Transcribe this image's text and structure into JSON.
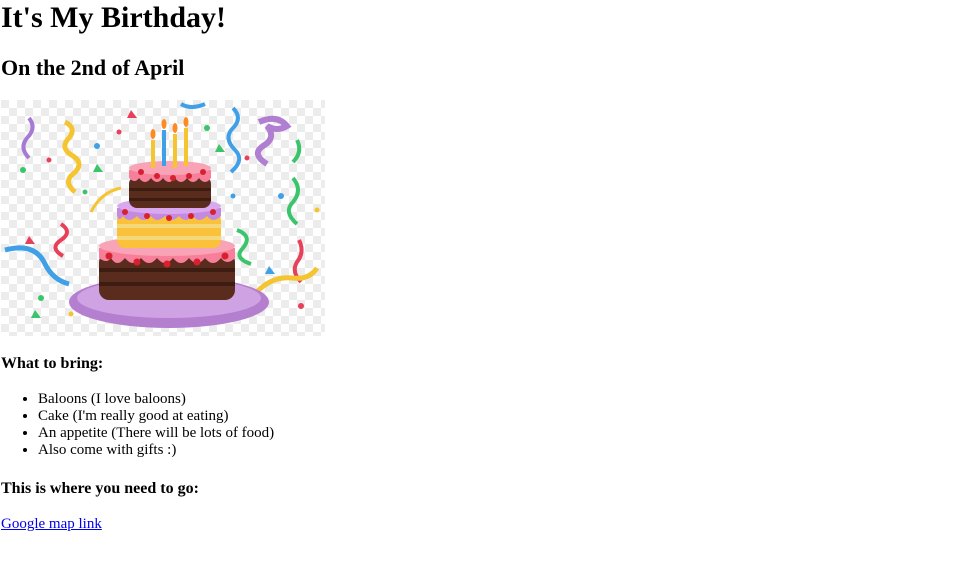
{
  "heading": "It's My Birthday!",
  "subheading": "On the 2nd of April",
  "image": {
    "icon": "birthday-cake-illustration"
  },
  "bring": {
    "heading": "What to bring:",
    "items": [
      "Baloons (I love baloons)",
      "Cake (I'm really good at eating)",
      "An appetite (There will be lots of food)",
      "Also come with gifts :)"
    ]
  },
  "directions": {
    "heading": "This is where you need to go:",
    "link_text": "Google map link"
  },
  "colors": {
    "link": "#0000ee",
    "text": "#000000",
    "background": "#ffffff"
  }
}
